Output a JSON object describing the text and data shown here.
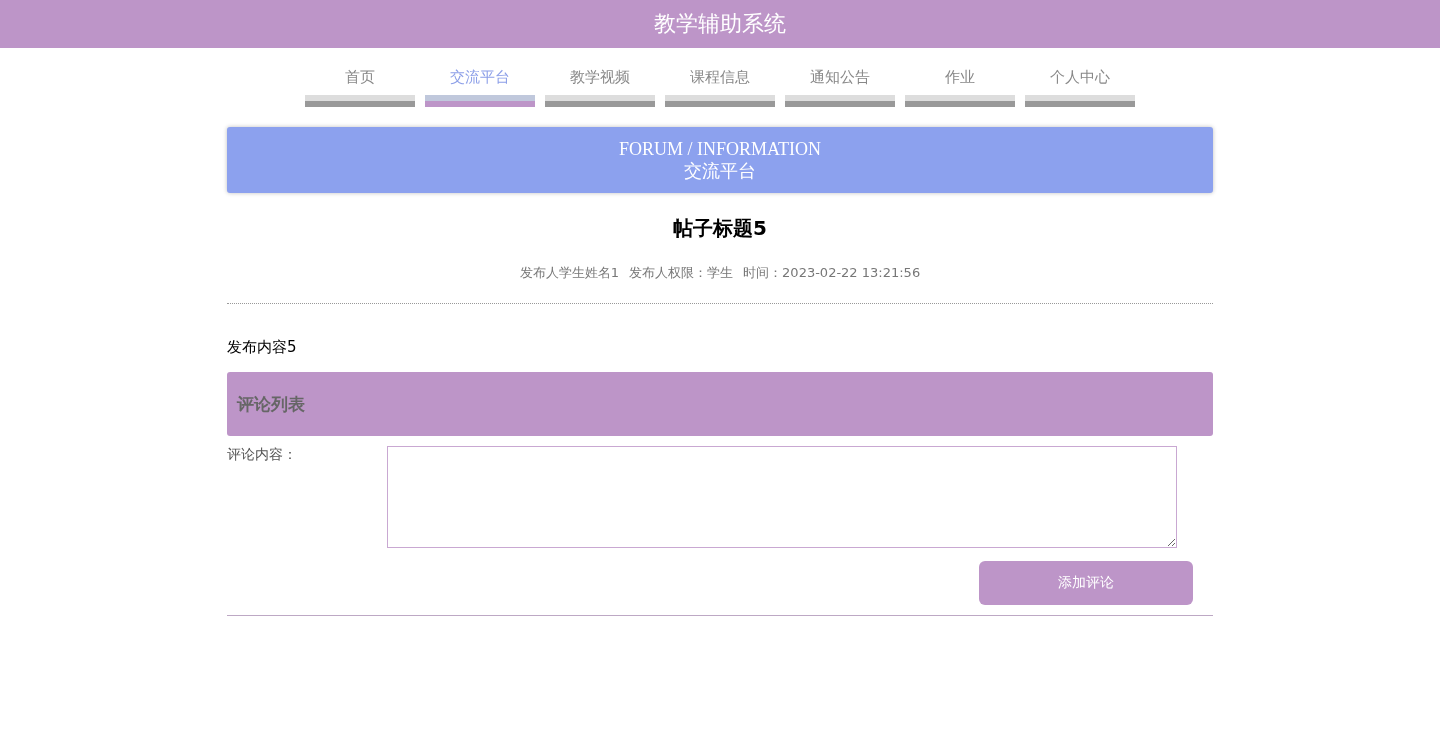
{
  "header": {
    "title": "教学辅助系统"
  },
  "nav": [
    {
      "label": "首页",
      "selected": false
    },
    {
      "label": "交流平台",
      "selected": true
    },
    {
      "label": "教学视频",
      "selected": false
    },
    {
      "label": "课程信息",
      "selected": false
    },
    {
      "label": "通知公告",
      "selected": false
    },
    {
      "label": "作业",
      "selected": false
    },
    {
      "label": "个人中心",
      "selected": false
    }
  ],
  "banner": {
    "title_en": "FORUM / INFORMATION",
    "title_cn": "交流平台"
  },
  "post": {
    "title": "帖子标题5",
    "meta": [
      "发布人学生姓名1",
      "发布人权限：学生",
      "时间：2023-02-22 13:21:56"
    ],
    "content": "发布内容5"
  },
  "comments": {
    "heading": "评论列表",
    "field_label": "评论内容：",
    "submit": "添加评论"
  }
}
